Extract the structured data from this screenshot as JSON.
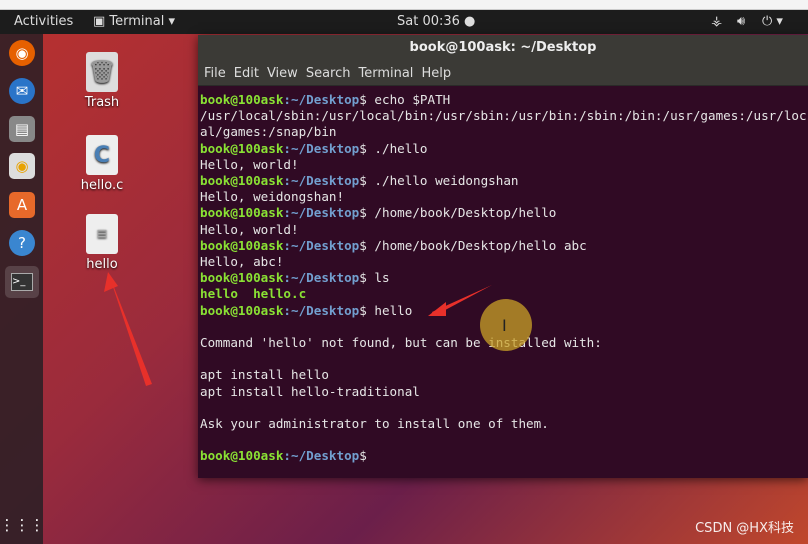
{
  "topbar": {
    "activities": "Activities",
    "app_menu": "Terminal ▾",
    "clock": "Sat 00:36 ●",
    "network_icon": "network-icon",
    "volume_icon": "volume-icon",
    "power_icon": "power-icon"
  },
  "dock": [
    "firefox-icon",
    "thunderbird-icon",
    "files-icon",
    "rhythmbox-icon",
    "software-icon",
    "help-icon",
    "terminal-icon",
    "app-grid-icon"
  ],
  "desktop_icons": [
    {
      "label": "Trash"
    },
    {
      "label": "hello.c"
    },
    {
      "label": "hello"
    }
  ],
  "terminal": {
    "title": "book@100ask: ~/Desktop",
    "menu": [
      "File",
      "Edit",
      "View",
      "Search",
      "Terminal",
      "Help"
    ],
    "prompt_user": "book@100ask",
    "prompt_path": "~/Desktop",
    "lines": [
      {
        "cmd": "echo $PATH"
      },
      {
        "text": "/usr/local/sbin:/usr/local/bin:/usr/sbin:/usr/bin:/sbin:/bin:/usr/games:/usr/loc"
      },
      {
        "text": "al/games:/snap/bin"
      },
      {
        "cmd": "./hello"
      },
      {
        "text": "Hello, world!"
      },
      {
        "cmd": "./hello weidongshan"
      },
      {
        "text": "Hello, weidongshan!"
      },
      {
        "cmd": "/home/book/Desktop/hello"
      },
      {
        "text": "Hello, world!"
      },
      {
        "cmd": "/home/book/Desktop/hello abc"
      },
      {
        "text": "Hello, abc!"
      },
      {
        "cmd": "ls"
      },
      {
        "text": "hello  hello.c",
        "bold": true
      },
      {
        "cmd": "hello"
      },
      {
        "text": ""
      },
      {
        "text": "Command 'hello' not found, but can be installed with:"
      },
      {
        "text": ""
      },
      {
        "text": "apt install hello"
      },
      {
        "text": "apt install hello-traditional"
      },
      {
        "text": ""
      },
      {
        "text": "Ask your administrator to install one of them."
      },
      {
        "text": ""
      },
      {
        "cmd": ""
      }
    ]
  },
  "watermark": "CSDN @HX科技"
}
